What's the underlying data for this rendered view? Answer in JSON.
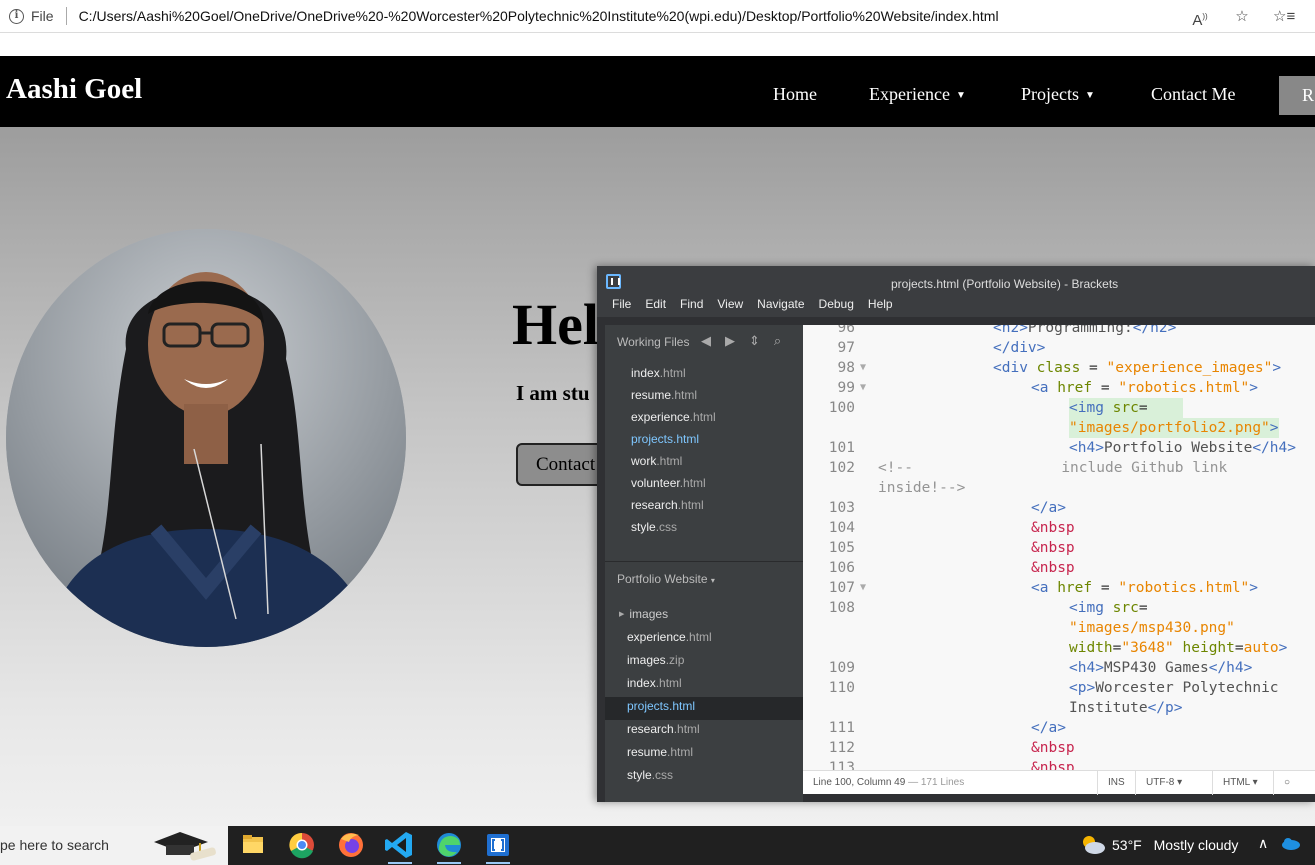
{
  "browser": {
    "site_label": "File",
    "url": "C:/Users/Aashi%20Goel/OneDrive/OneDrive%20-%20Worcester%20Polytechnic%20Institute%20(wpi.edu)/Desktop/Portfolio%20Website/index.html"
  },
  "site": {
    "brand": "Aashi Goel",
    "nav": [
      {
        "label": "Home"
      },
      {
        "label": "Experience"
      },
      {
        "label": "Projects"
      },
      {
        "label": "Contact Me"
      }
    ],
    "nav_button": "R",
    "hero_title": "Hel",
    "hero_subtitle": "I am stu",
    "hero_button": "Contact"
  },
  "brackets": {
    "title": "projects.html (Portfolio Website) - Brackets",
    "menu": [
      "File",
      "Edit",
      "Find",
      "View",
      "Navigate",
      "Debug",
      "Help"
    ],
    "working_files_label": "Working Files",
    "working_files": [
      {
        "name": "index",
        "ext": ".html"
      },
      {
        "name": "resume",
        "ext": ".html"
      },
      {
        "name": "experience",
        "ext": ".html"
      },
      {
        "name": "projects",
        "ext": ".html"
      },
      {
        "name": "work",
        "ext": ".html"
      },
      {
        "name": "volunteer",
        "ext": ".html"
      },
      {
        "name": "research",
        "ext": ".html"
      },
      {
        "name": "style",
        "ext": ".css"
      }
    ],
    "project_label": "Portfolio Website",
    "project_files": [
      {
        "name": "images",
        "ext": ""
      },
      {
        "name": "experience",
        "ext": ".html"
      },
      {
        "name": "images",
        "ext": ".zip"
      },
      {
        "name": "index",
        "ext": ".html"
      },
      {
        "name": "projects",
        "ext": ".html"
      },
      {
        "name": "research",
        "ext": ".html"
      },
      {
        "name": "resume",
        "ext": ".html"
      },
      {
        "name": "style",
        "ext": ".css"
      }
    ],
    "status": {
      "position": "Line 100, Column 49",
      "lines": "— 171 Lines",
      "ins": "INS",
      "encoding": "UTF-8",
      "language": "HTML"
    }
  },
  "taskbar": {
    "search": "pe here to search",
    "temperature": "53°F",
    "weather": "Mostly cloudy"
  }
}
